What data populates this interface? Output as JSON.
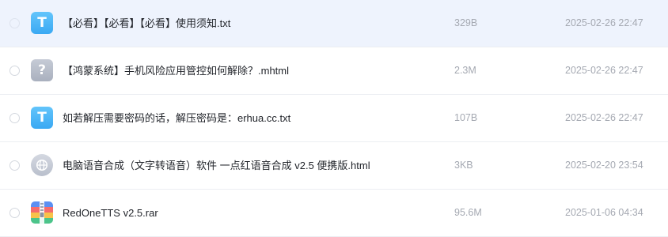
{
  "files": [
    {
      "name": "【必看】【必看】【必看】使用须知.txt",
      "size": "329B",
      "date": "2025-02-26 22:47",
      "icon": "txt-file-icon",
      "icon_glyph": "T",
      "selected": true
    },
    {
      "name": "【鸿蒙系统】手机风险应用管控如何解除？.mhtml",
      "size": "2.3M",
      "date": "2025-02-26 22:47",
      "icon": "unknown-file-icon",
      "icon_glyph": "?",
      "selected": false
    },
    {
      "name": "如若解压需要密码的话，解压密码是：erhua.cc.txt",
      "size": "107B",
      "date": "2025-02-26 22:47",
      "icon": "txt-file-icon",
      "icon_glyph": "T",
      "selected": false
    },
    {
      "name": "电脑语音合成（文字转语音）软件 一点红语音合成 v2.5 便携版.html",
      "size": "3KB",
      "date": "2025-02-20 23:54",
      "icon": "globe-file-icon",
      "selected": false
    },
    {
      "name": "RedOneTTS v2.5.rar",
      "size": "95.6M",
      "date": "2025-01-06 04:34",
      "icon": "archive-file-icon",
      "selected": false
    }
  ],
  "colors": {
    "selected_row_bg": "#eef3fd",
    "txt_icon": "#3aa9f3",
    "unknown_icon": "#a9b0be",
    "meta_text": "#a5a9b2",
    "name_text": "#22252b"
  }
}
